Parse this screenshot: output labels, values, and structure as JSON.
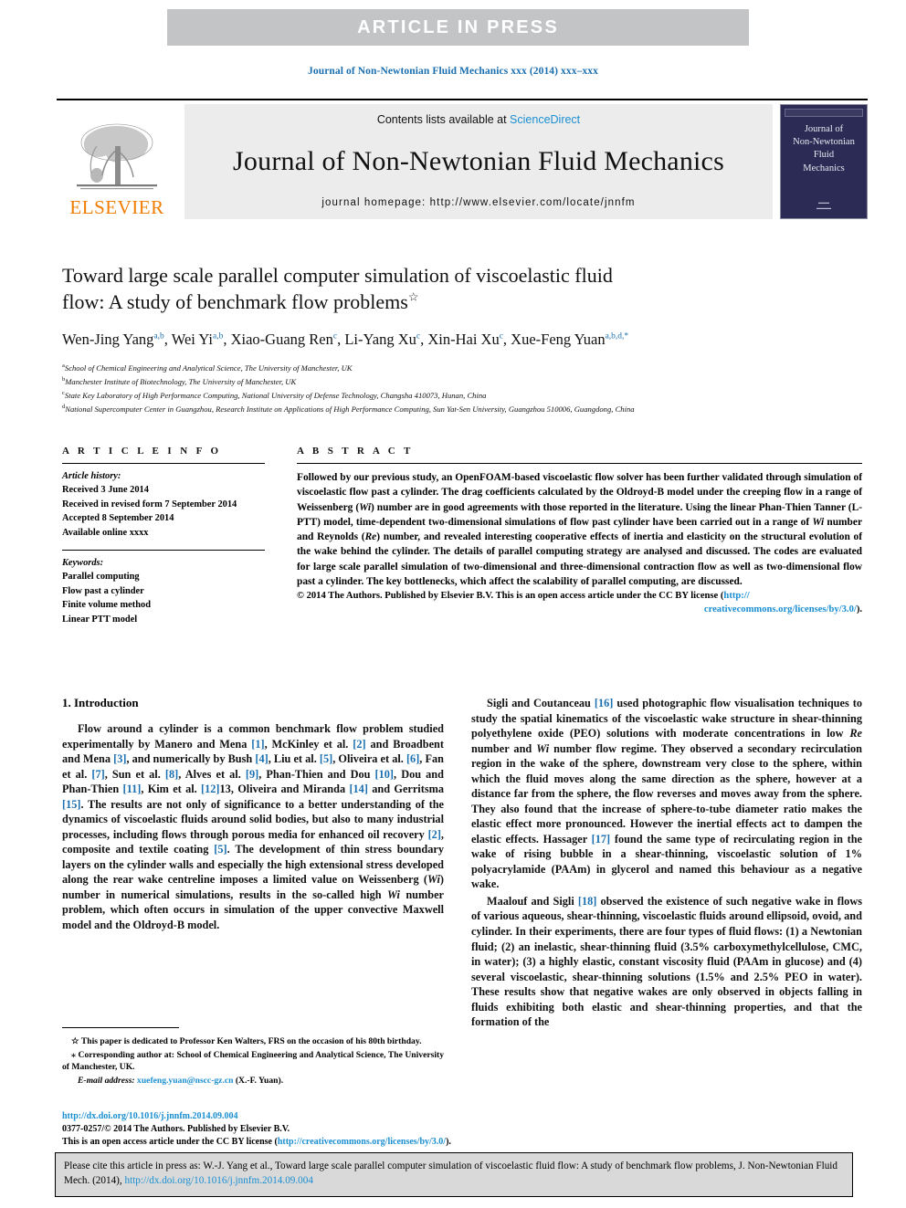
{
  "banner": {
    "text": "ARTICLE  IN  PRESS"
  },
  "running_head": "Journal of Non-Newtonian Fluid Mechanics xxx (2014) xxx–xxx",
  "masthead": {
    "publisher_name": "ELSEVIER",
    "contents_prefix": "Contents lists available at ",
    "contents_link": "ScienceDirect",
    "journal_name": "Journal of Non-Newtonian Fluid Mechanics",
    "homepage_label": "journal homepage: http://www.elsevier.com/locate/jnnfm",
    "cover_title": "Journal of\nNon-Newtonian\nFluid\nMechanics",
    "cover_line1": "Journal of",
    "cover_line2": "Non-Newtonian",
    "cover_line3": "Fluid",
    "cover_line4": "Mechanics"
  },
  "title": {
    "line1": "Toward large scale parallel computer simulation of viscoelastic fluid",
    "line2": "flow: A study of benchmark flow problems",
    "dagger": "☆"
  },
  "authors": [
    {
      "name": "Wen-Jing Yang",
      "marks": "a,b"
    },
    {
      "name": "Wei Yi",
      "marks": "a,b"
    },
    {
      "name": "Xiao-Guang Ren",
      "marks": "c"
    },
    {
      "name": "Li-Yang Xu",
      "marks": "c"
    },
    {
      "name": "Xin-Hai Xu",
      "marks": "c"
    },
    {
      "name": "Xue-Feng Yuan",
      "marks": "a,b,d,*"
    }
  ],
  "affiliations": [
    {
      "mark": "a",
      "text": "School of Chemical Engineering and Analytical Science, The University of Manchester, UK"
    },
    {
      "mark": "b",
      "text": "Manchester Institute of Biotechnology, The University of Manchester, UK"
    },
    {
      "mark": "c",
      "text": "State Key Laboratory of High Performance Computing, National University of Defense Technology, Changsha 410073, Hunan, China"
    },
    {
      "mark": "d",
      "text": "National Supercomputer Center in Guangzhou, Research Institute on Applications of High Performance Computing, Sun Yat-Sen University, Guangzhou 510006, Guangdong, China"
    }
  ],
  "article_info": {
    "heading": "A R T I C L E   I N F O",
    "history_label": "Article history:",
    "history": [
      "Received 3 June 2014",
      "Received in revised form 7 September 2014",
      "Accepted 8 September 2014",
      "Available online xxxx"
    ],
    "keywords_label": "Keywords:",
    "keywords": [
      "Parallel computing",
      "Flow past a cylinder",
      "Finite volume method",
      "Linear PTT model"
    ]
  },
  "abstract": {
    "heading": "A B S T R A C T",
    "text_part1": "Followed by our previous study, an OpenFOAM-based viscoelastic flow solver has been further validated through simulation of viscoelastic flow past a cylinder. The drag coefficients calculated by the Oldroyd-B model under the creeping flow in a range of Weissenberg (",
    "wi_1": "Wi",
    "text_part2": ") number are in good agreements with those reported in the literature. Using the linear Phan-Thien Tanner (L-PTT) model, time-dependent two-dimensional simulations of flow past cylinder have been carried out in a range of ",
    "wi_2": "Wi",
    "text_part3": " number and Reynolds (",
    "re_1": "Re",
    "text_part4": ") number, and revealed interesting cooperative effects of inertia and elasticity on the structural evolution of the wake behind the cylinder. The details of parallel computing strategy are analysed and discussed. The codes are evaluated for large scale parallel simulation of two-dimensional and three-dimensional contraction flow as well as two-dimensional flow past a cylinder. The key bottlenecks, which affect the scalability of parallel computing, are discussed.",
    "copyright": "© 2014 The Authors. Published by Elsevier B.V. This is an open access article under the CC BY license (",
    "license_url_line1": "http://",
    "license_url_line2": "creativecommons.org/licenses/by/3.0/",
    "copyright_tail": ")."
  },
  "introduction": {
    "heading": "1. Introduction",
    "paragraph1_a": "Flow around a cylinder is a common benchmark flow problem studied experimentally by Manero and Mena ",
    "r1": "[1]",
    "paragraph1_b": ", McKinley et al. ",
    "r2": "[2]",
    "paragraph1_c": " and Broadbent and Mena ",
    "r3": "[3]",
    "paragraph1_d": ", and numerically by Bush ",
    "r4": "[4]",
    "paragraph1_e": ", Liu et al. ",
    "r5": "[5]",
    "paragraph1_f": ", Oliveira et al. ",
    "r6": "[6]",
    "paragraph1_g": ", Fan et al. ",
    "r7": "[7]",
    "paragraph1_h": ", Sun et al. ",
    "r8": "[8]",
    "paragraph1_i": ", Alves et al. ",
    "r9": "[9]",
    "paragraph1_j": ", Phan-Thien and Dou ",
    "r10": "[10]",
    "paragraph1_k": ", Dou and Phan-Thien ",
    "r11": "[11]",
    "paragraph1_l": ", Kim et al. ",
    "r12": "[12]",
    "paragraph1_m": "13, Oliveira and Miranda ",
    "r14": "[14]",
    "paragraph1_n": " and Gerritsma ",
    "r15": "[15]",
    "paragraph1_o": ". The results are not only of significance to a better understanding of the dynamics of viscoelastic fluids around solid bodies, but also to many industrial processes, including flows through porous media for enhanced oil recovery ",
    "r2b": "[2]",
    "paragraph1_p": ", composite and textile coating ",
    "r5b": "[5]",
    "paragraph1_q": ". The development of thin stress boundary layers on the cylinder walls and especially the high extensional stress developed along the rear wake centreline imposes a limited value on Weissenberg (",
    "wi_a": "Wi",
    "paragraph1_r": ") number in numerical simulations, results in the so-called high ",
    "wi_b": "Wi",
    "paragraph1_s": " number problem, which often occurs in simulation of the upper convective Maxwell model and the Oldroyd-B model."
  },
  "right_column": {
    "p1_a": "Sigli and Coutanceau ",
    "r16": "[16]",
    "p1_b": " used photographic flow visualisation techniques to study the spatial kinematics of the viscoelastic wake structure in shear-thinning polyethylene oxide (PEO) solutions with moderate concentrations in low ",
    "re_a": "Re",
    "p1_c": " number and ",
    "wi_a": "Wi",
    "p1_d": " number flow regime. They observed a secondary recirculation region in the wake of the sphere, downstream very close to the sphere, within which the fluid moves along the same direction as the sphere, however at a distance far from the sphere, the flow reverses and moves away from the sphere. They also found that the increase of sphere-to-tube diameter ratio makes the elastic effect more pronounced. However the inertial effects act to dampen the elastic effects. Hassager ",
    "r17": "[17]",
    "p1_e": " found the same type of recirculating region in the wake of rising bubble in a shear-thinning, viscoelastic solution of 1% polyacrylamide (PAAm) in glycerol and named this behaviour as a negative wake.",
    "p2_a": "Maalouf and Sigli ",
    "r18": "[18]",
    "p2_b": " observed the existence of such negative wake in flows of various aqueous, shear-thinning, viscoelastic fluids around ellipsoid, ovoid, and cylinder. In their experiments, there are four types of fluid flows: (1) a Newtonian fluid; (2) an inelastic, shear-thinning fluid (3.5% carboxymethylcellulose, CMC, in water); (3) a highly elastic, constant viscosity fluid (PAAm in glucose) and (4) several viscoelastic, shear-thinning solutions (1.5% and 2.5% PEO in water). These results show that negative wakes are only observed in objects falling in fluids exhibiting both elastic and shear-thinning properties, and that the formation of the"
  },
  "footnotes": {
    "star_note": "This paper is dedicated to Professor Ken Walters, FRS on the occasion of his 80th birthday.",
    "star_symbol": "☆",
    "corresponding_symbol": "⁎",
    "corresponding_note": "Corresponding author at: School of Chemical Engineering and Analytical Science, The University of Manchester, UK.",
    "email_label": "E-mail address:",
    "email": "xuefeng.yuan@nscc-gz.cn",
    "email_owner": "(X.-F. Yuan)."
  },
  "imprint": {
    "doi": "http://dx.doi.org/10.1016/j.jnnfm.2014.09.004",
    "issn_line": "0377-0257/© 2014 The Authors. Published by Elsevier B.V.",
    "license_prefix": "This is an open access article under the CC BY license (",
    "license_url": "http://creativecommons.org/licenses/by/3.0/",
    "license_suffix": ")."
  },
  "cite_box": {
    "text_a": "Please cite this article in press as: W.-J. Yang et al., Toward large scale parallel computer simulation of viscoelastic fluid flow: A study of benchmark flow problems, J. Non-Newtonian Fluid Mech. (2014), ",
    "link": "http://dx.doi.org/10.1016/j.jnnfm.2014.09.004"
  },
  "colors": {
    "banner_gray": "#c3c4c6",
    "link_blue": "#1a8fd1",
    "ref_blue": "#1a6fb0",
    "elsevier_orange": "#f07d00",
    "cover_navy": "#2b2b55",
    "cite_box_gray": "#d9d9d9"
  }
}
